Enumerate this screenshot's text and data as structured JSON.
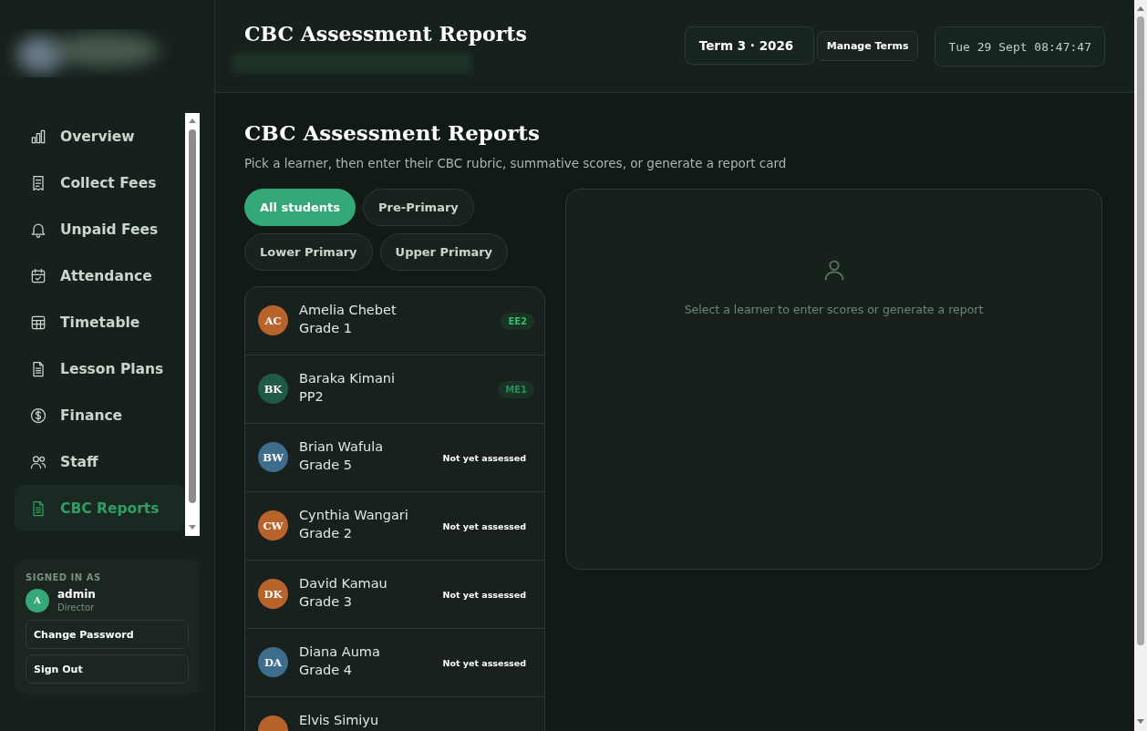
{
  "sidebar": {
    "items": [
      {
        "label": "Overview",
        "selected": false
      },
      {
        "label": "Collect Fees",
        "selected": false
      },
      {
        "label": "Unpaid Fees",
        "selected": false
      },
      {
        "label": "Attendance",
        "selected": false
      },
      {
        "label": "Timetable",
        "selected": false
      },
      {
        "label": "Lesson Plans",
        "selected": false
      },
      {
        "label": "Finance",
        "selected": false
      },
      {
        "label": "Staff",
        "selected": false
      },
      {
        "label": "CBC Reports",
        "selected": true
      }
    ],
    "user": {
      "heading": "SIGNED IN AS",
      "initial": "A",
      "name": "admin",
      "role": "Director",
      "buttons": [
        "Change Password",
        "Sign Out"
      ]
    }
  },
  "header": {
    "title": "CBC Assessment Reports",
    "term": "Term 3 · 2026",
    "manage_button": "Manage Terms",
    "clock": "Tue 29 Sept 08:47:47"
  },
  "page": {
    "title": "CBC Assessment Reports",
    "subtitle": "Pick a learner, then enter their CBC rubric, summative scores, or generate a report card",
    "filters": [
      {
        "label": "All students",
        "selected": true
      },
      {
        "label": "Pre-Primary",
        "selected": false
      },
      {
        "label": "Lower Primary",
        "selected": false
      },
      {
        "label": "Upper Primary",
        "selected": false
      }
    ],
    "learners": [
      {
        "initials": "AC",
        "name": "Amelia Chebet",
        "grade": "Grade 1",
        "color": "#b8622c",
        "badge": {
          "kind": "level",
          "text": "EE2",
          "color": "#2fbf71"
        }
      },
      {
        "initials": "BK",
        "name": "Baraka Kimani",
        "grade": "PP2",
        "color": "#1f5a45",
        "badge": {
          "kind": "level",
          "text": "ME1",
          "color": "#2a8a5a"
        }
      },
      {
        "initials": "BW",
        "name": "Brian Wafula",
        "grade": "Grade 5",
        "color": "#3f6d8c",
        "badge": {
          "kind": "status",
          "text": "Not yet assessed"
        }
      },
      {
        "initials": "CW",
        "name": "Cynthia Wangari",
        "grade": "Grade 2",
        "color": "#b8622c",
        "badge": {
          "kind": "status",
          "text": "Not yet assessed"
        }
      },
      {
        "initials": "DK",
        "name": "David Kamau",
        "grade": "Grade 3",
        "color": "#b8622c",
        "badge": {
          "kind": "status",
          "text": "Not yet assessed"
        }
      },
      {
        "initials": "DA",
        "name": "Diana Auma",
        "grade": "Grade 4",
        "color": "#3f6d8c",
        "badge": {
          "kind": "status",
          "text": "Not yet assessed"
        }
      },
      {
        "name": "Elvis Simiyu",
        "color": "#b8622c"
      }
    ],
    "empty_message": "Select a learner to enter scores or generate a report"
  }
}
